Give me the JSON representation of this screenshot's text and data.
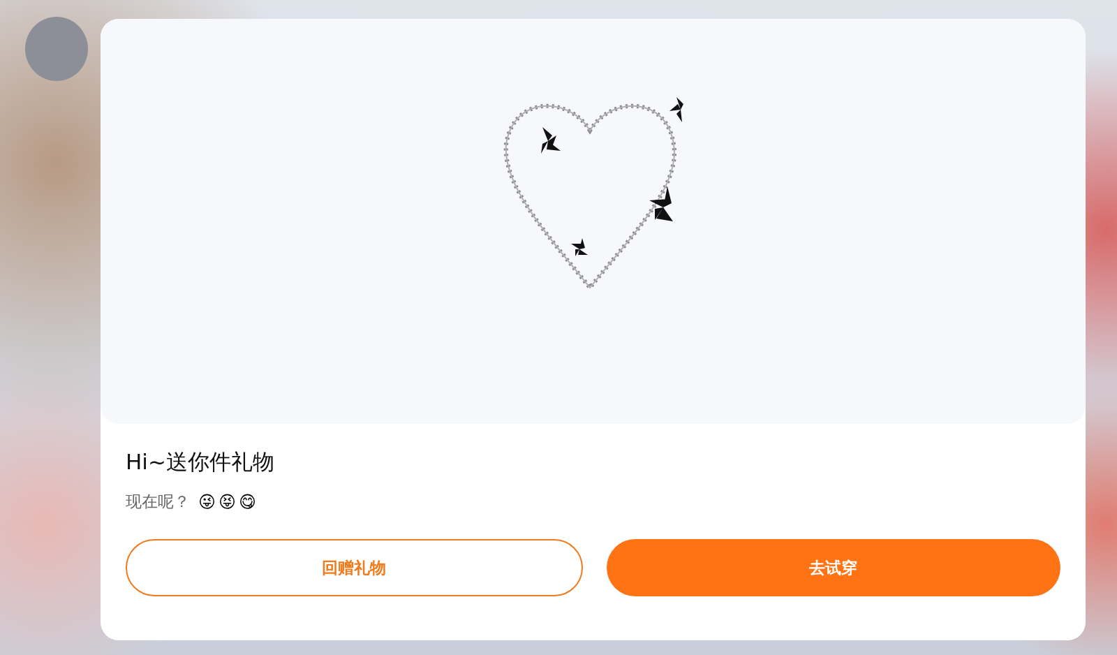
{
  "gift_card": {
    "title": "Hi~送你件礼物",
    "message": "现在呢？",
    "emojis": [
      "😜",
      "😝",
      "😋"
    ],
    "buttons": [
      {
        "label": "回赠礼物",
        "kind": "outline"
      },
      {
        "label": "去试穿",
        "kind": "filled"
      }
    ]
  }
}
